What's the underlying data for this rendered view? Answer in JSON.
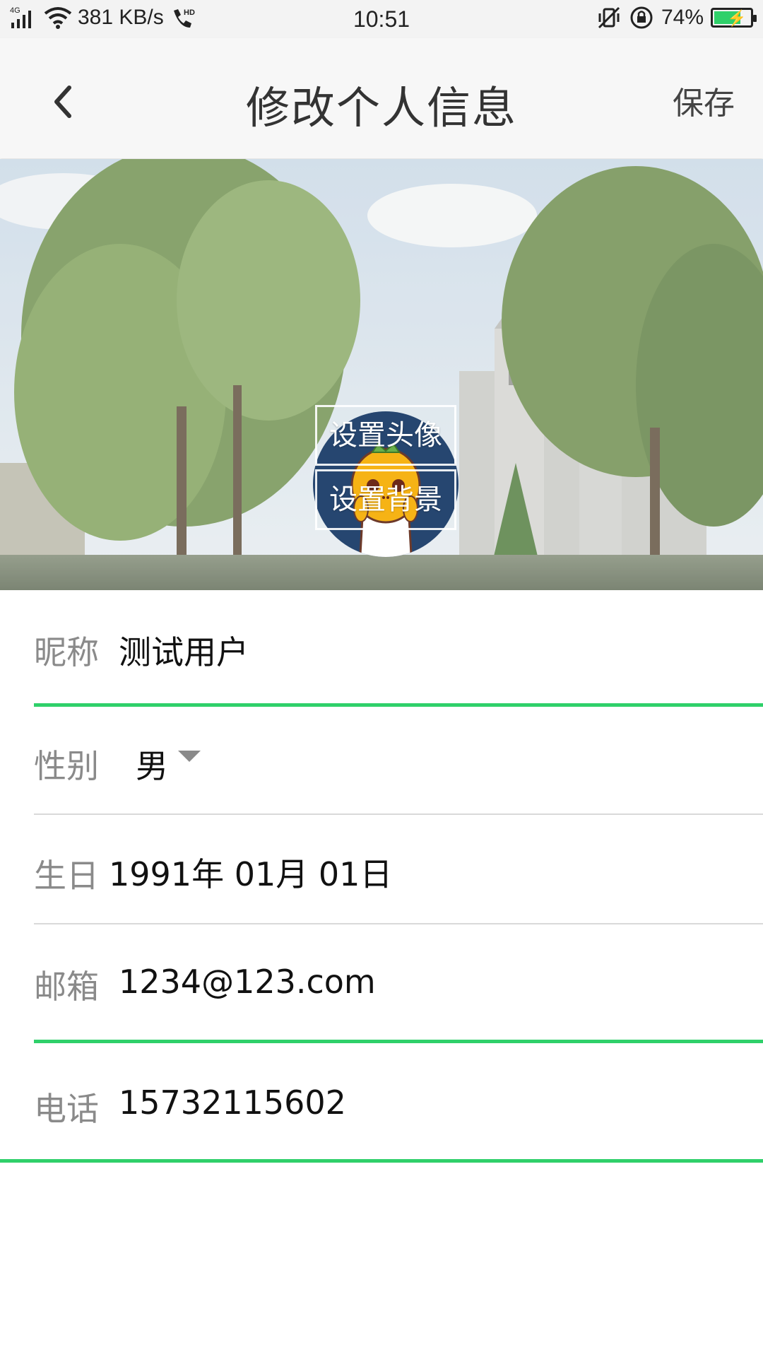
{
  "status_bar": {
    "network": "4G",
    "speed": "381 KB/s",
    "hd": "HD",
    "time": "10:51",
    "battery": "74%",
    "icons": [
      "signal-icon",
      "wifi-icon",
      "hd-call-icon",
      "vibrate-icon",
      "rotation-lock-icon",
      "battery-icon"
    ],
    "battery_level": 0.74
  },
  "app_bar": {
    "title": "修改个人信息",
    "save_label": "保存",
    "back_icon": "chevron-left-icon"
  },
  "banner": {
    "set_avatar_label": "设置头像",
    "set_background_label": "设置背景"
  },
  "form": {
    "nickname": {
      "label": "昵称",
      "value": "测试用户"
    },
    "gender": {
      "label": "性别",
      "value": "男"
    },
    "birthday": {
      "label": "生日",
      "value": "1991年 01月 01日"
    },
    "email": {
      "label": "邮箱",
      "value": "1234@123.com"
    },
    "phone": {
      "label": "电话",
      "value": "15732115602"
    }
  },
  "colors": {
    "accent": "#2fd06a",
    "label_gray": "#8a8a8a",
    "avatar_bg": "#264670"
  }
}
